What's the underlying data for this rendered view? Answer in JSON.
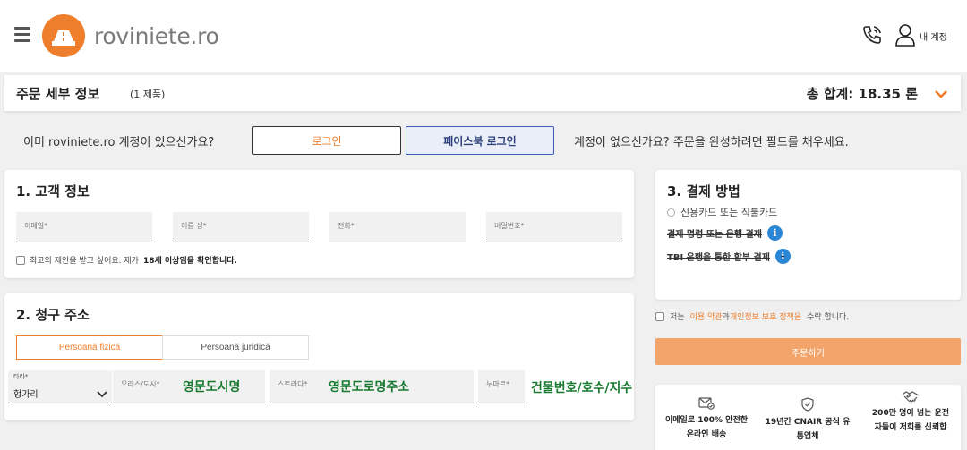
{
  "header": {
    "logo_text": "roviniete.ro",
    "account_label": "내 계정",
    "brand_color": "#ee7d2c",
    "icons": [
      "menu-icon",
      "phone-icon",
      "user-icon"
    ]
  },
  "order": {
    "title": "주문 세부 정보",
    "count": "(1 제품)",
    "total": "총 합계: 18.35 론"
  },
  "login": {
    "question": "이미 roviniete.ro 계정이 있으신가요?",
    "login_button": "로그인",
    "facebook_button": "페이스북 로그인",
    "register_text": "계정이 없으신가요? 주문을 완성하려면 필드를 채우세요."
  },
  "customer": {
    "title": "1. 고객 정보",
    "fields": {
      "email_placeholder": "이메일*",
      "name_placeholder": "이름 성*",
      "phone_placeholder": "전화*",
      "password_placeholder": "비밀번호*"
    },
    "consent_prefix": "최고의 제안을 받고 싶어요. 제가",
    "consent_bold": "18세 이상임을 확인합니다."
  },
  "billing": {
    "title": "2. 청구 주소",
    "tab_person": "Persoană fizică",
    "tab_company": "Persoană juridică",
    "country_label": "타라*",
    "country_value": "헝가리",
    "city_placeholder": "오라스/도시*",
    "city_value": "영문도시명",
    "street_placeholder": "스트라다*",
    "street_value": "영문도로명주소",
    "number_placeholder": "누마르*",
    "number_value": "건물번호/호수/지수"
  },
  "payment": {
    "title": "3. 결제 방법",
    "option_card": "신용카드 또는 직불카드",
    "option_transfer": "결제 명령 또는 은행 결제",
    "option_tbi": "TBI 은행을 통한 할부 결제"
  },
  "terms": {
    "prefix": "저는",
    "terms_link": "이용 약관",
    "conj": "과",
    "privacy_link": "개인정보 보호 정책을",
    "suffix": "수락 합니다."
  },
  "order_button": "주문하기",
  "trust": [
    {
      "icon": "envelope-check-icon",
      "line1": "이메일로 100% 안전한",
      "line2": "온라인 배송"
    },
    {
      "icon": "shield-check-icon",
      "line1": "19년간 CNAIR 공식 유",
      "line2": "통업체"
    },
    {
      "icon": "handshake-icon",
      "line1": "200만 명이 넘는 운전",
      "line2": "자들이 저희를 신뢰합"
    }
  ]
}
